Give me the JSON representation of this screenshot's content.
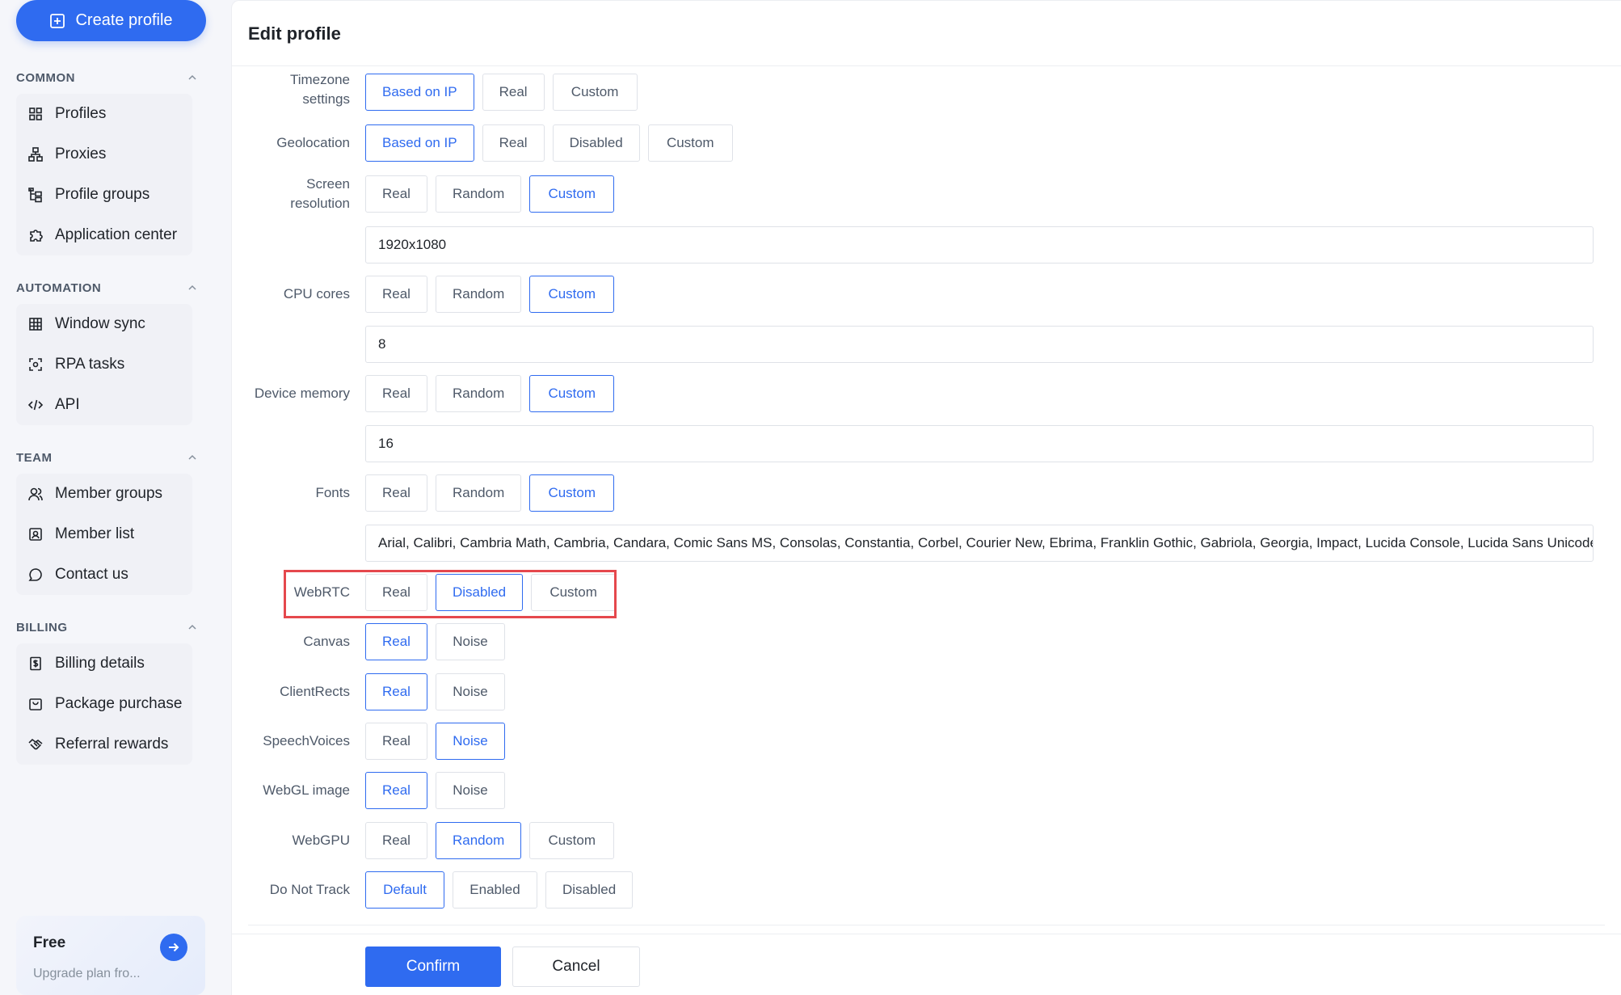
{
  "sidebar": {
    "create_label": "Create profile",
    "sections": [
      {
        "title": "COMMON",
        "items": [
          "Profiles",
          "Proxies",
          "Profile groups",
          "Application center"
        ]
      },
      {
        "title": "AUTOMATION",
        "items": [
          "Window sync",
          "RPA tasks",
          "API"
        ]
      },
      {
        "title": "TEAM",
        "items": [
          "Member groups",
          "Member list",
          "Contact us"
        ]
      },
      {
        "title": "BILLING",
        "items": [
          "Billing details",
          "Package purchase",
          "Referral rewards"
        ]
      }
    ],
    "plan": {
      "title": "Free",
      "subtitle": "Upgrade plan fro..."
    }
  },
  "panel": {
    "title": "Edit profile"
  },
  "form": {
    "timezone": {
      "label": "Timezone settings",
      "options": [
        "Based on IP",
        "Real",
        "Custom"
      ],
      "selected": "Based on IP"
    },
    "geolocation": {
      "label": "Geolocation",
      "options": [
        "Based on IP",
        "Real",
        "Disabled",
        "Custom"
      ],
      "selected": "Based on IP"
    },
    "screen": {
      "label": "Screen resolution",
      "options": [
        "Real",
        "Random",
        "Custom"
      ],
      "selected": "Custom",
      "value": "1920x1080"
    },
    "cpu": {
      "label": "CPU cores",
      "options": [
        "Real",
        "Random",
        "Custom"
      ],
      "selected": "Custom",
      "value": "8"
    },
    "memory": {
      "label": "Device memory",
      "options": [
        "Real",
        "Random",
        "Custom"
      ],
      "selected": "Custom",
      "value": "16"
    },
    "fonts": {
      "label": "Fonts",
      "options": [
        "Real",
        "Random",
        "Custom"
      ],
      "selected": "Custom",
      "value": "Arial, Calibri, Cambria Math, Cambria, Candara, Comic Sans MS, Consolas, Constantia, Corbel, Courier New, Ebrima, Franklin Gothic, Gabriola, Georgia, Impact, Lucida Console, Lucida Sans Unicode"
    },
    "webrtc": {
      "label": "WebRTC",
      "options": [
        "Real",
        "Disabled",
        "Custom"
      ],
      "selected": "Disabled"
    },
    "canvas": {
      "label": "Canvas",
      "options": [
        "Real",
        "Noise"
      ],
      "selected": "Real"
    },
    "clientrects": {
      "label": "ClientRects",
      "options": [
        "Real",
        "Noise"
      ],
      "selected": "Real"
    },
    "speechvoices": {
      "label": "SpeechVoices",
      "options": [
        "Real",
        "Noise"
      ],
      "selected": "Noise"
    },
    "webglimage": {
      "label": "WebGL image",
      "options": [
        "Real",
        "Noise"
      ],
      "selected": "Real"
    },
    "webgpu": {
      "label": "WebGPU",
      "options": [
        "Real",
        "Random",
        "Custom"
      ],
      "selected": "Random"
    },
    "dnt": {
      "label": "Do Not Track",
      "options": [
        "Default",
        "Enabled",
        "Disabled"
      ],
      "selected": "Default"
    }
  },
  "actions": {
    "confirm": "Confirm",
    "cancel": "Cancel"
  },
  "colors": {
    "accent": "#2f6bf0",
    "highlight": "#e5484d"
  }
}
